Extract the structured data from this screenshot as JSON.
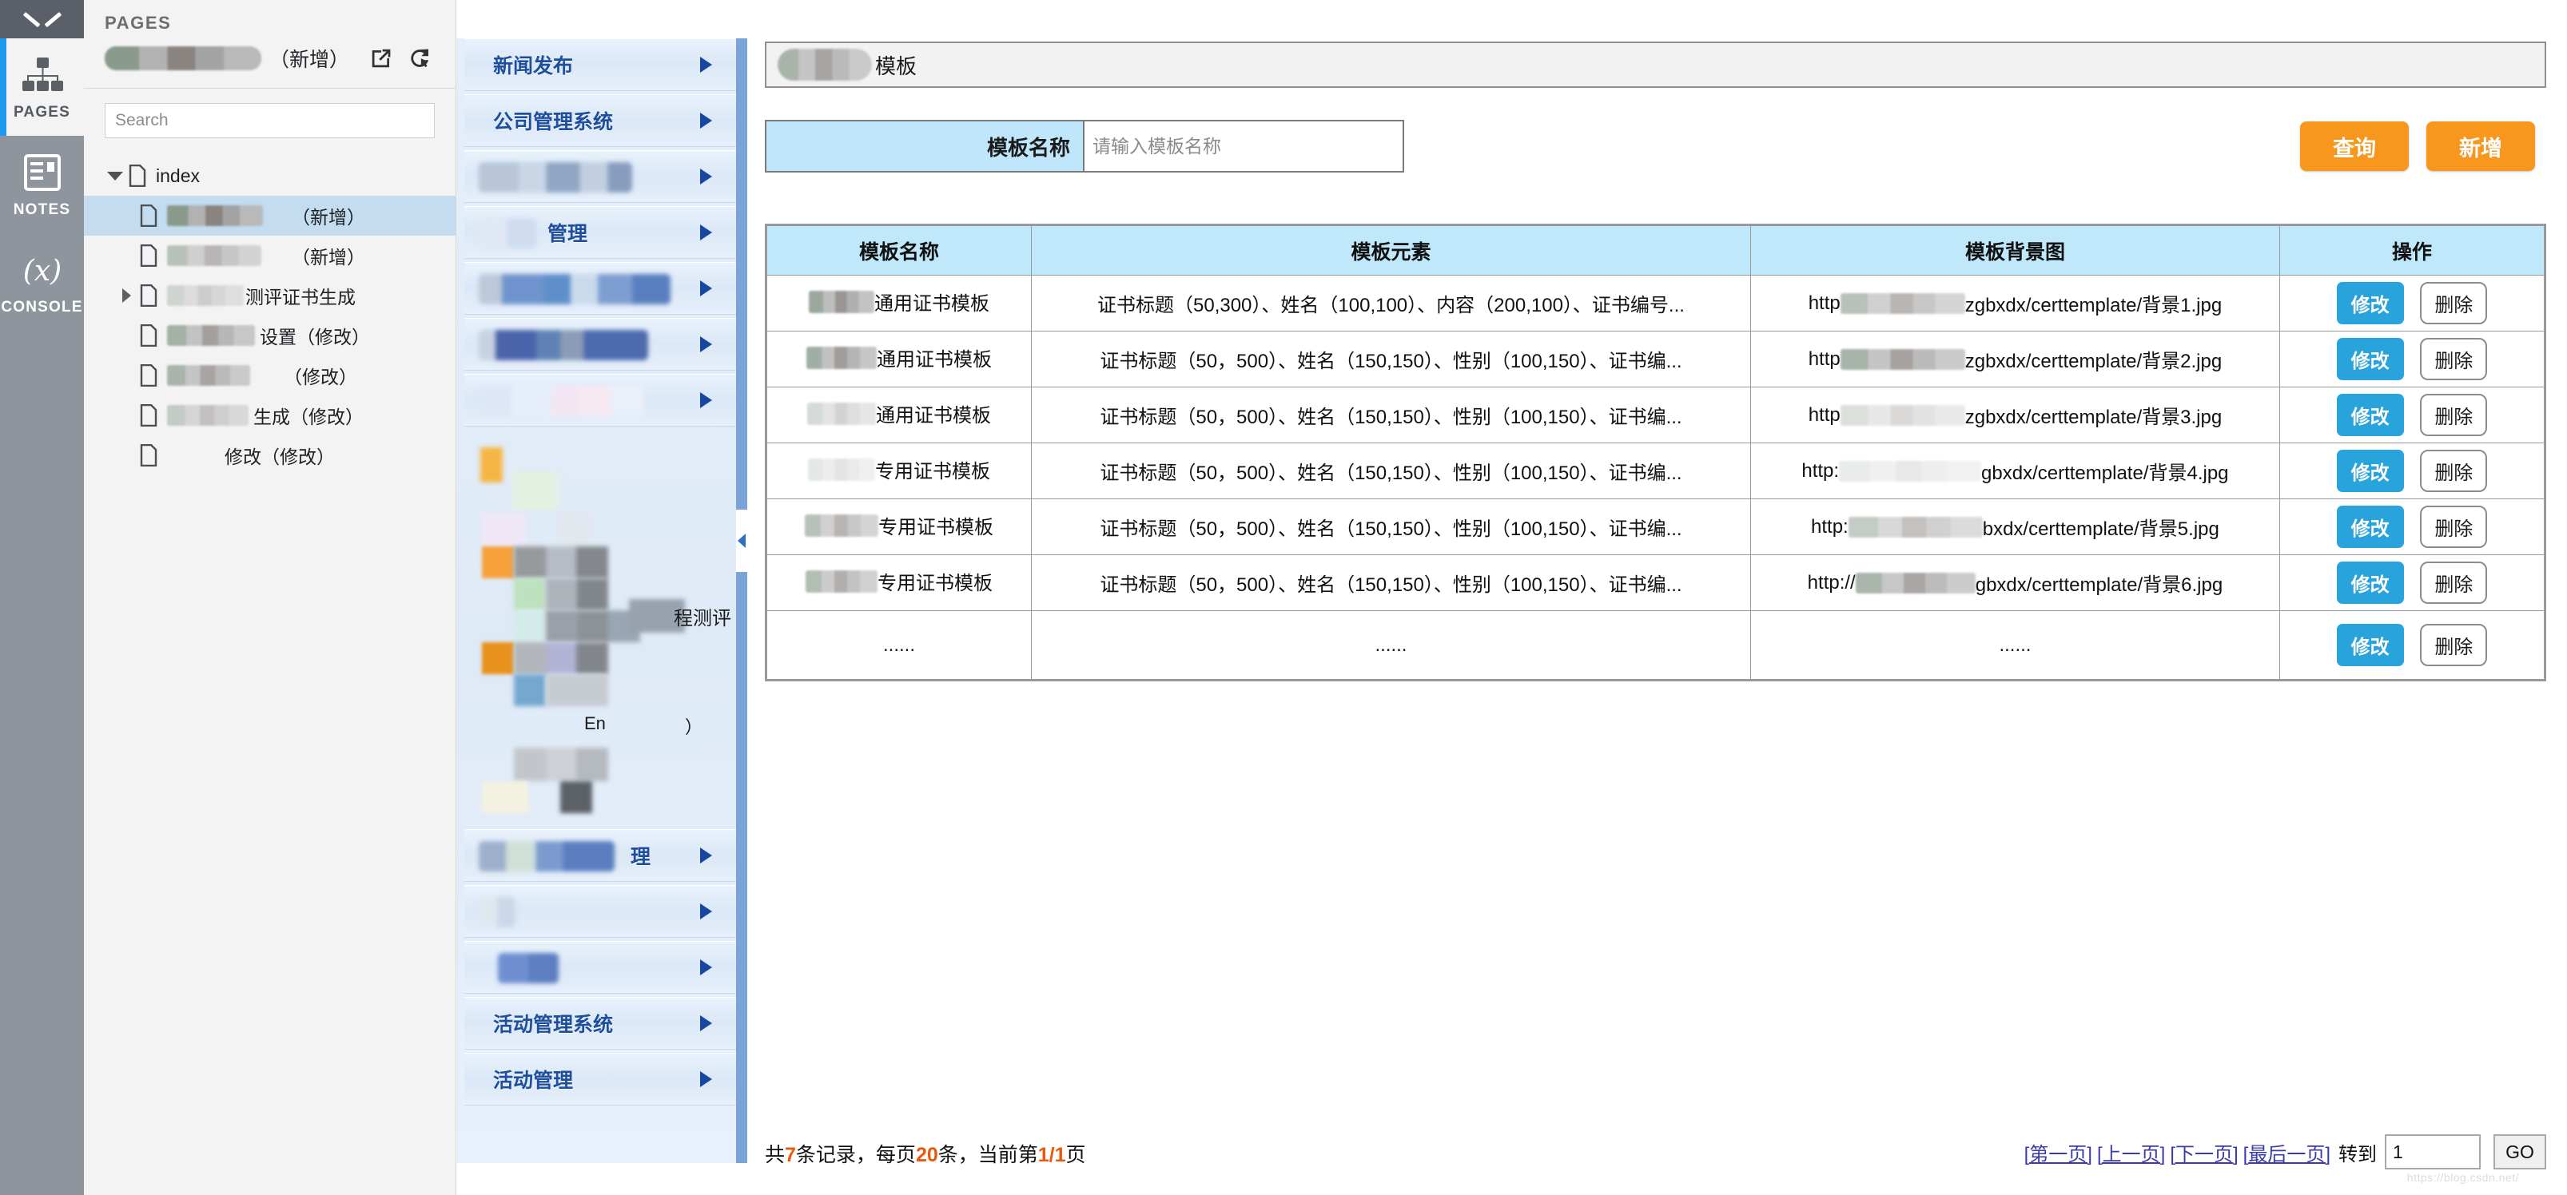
{
  "axure": {
    "rail": {
      "collapse_icon": "chevron-down-icon",
      "items": [
        {
          "label": "PAGES",
          "icon": "sitemap-icon",
          "active": true
        },
        {
          "label": "NOTES",
          "icon": "notes-icon",
          "active": false
        },
        {
          "label": "CONSOLE",
          "icon": "variable-x-icon",
          "active": false
        }
      ]
    },
    "pages_panel": {
      "title": "PAGES",
      "current_page_suffix": "（新增）",
      "open_icon": "open-in-new-window-icon",
      "reload_icon": "reload-cursor-icon",
      "search_placeholder": "Search",
      "search_value": "",
      "tree": [
        {
          "label": "index",
          "level": 0,
          "arrow": "down",
          "selected": false
        },
        {
          "label": "（新增）",
          "level": 1,
          "arrow": "none",
          "selected": true
        },
        {
          "label": "（新增）",
          "level": 1,
          "arrow": "none",
          "selected": false
        },
        {
          "label": "测评证书生成",
          "level": 1,
          "arrow": "right",
          "selected": false
        },
        {
          "label": "设置（修改）",
          "level": 1,
          "arrow": "none",
          "selected": false
        },
        {
          "label": "（修改）",
          "level": 1,
          "arrow": "none",
          "selected": false
        },
        {
          "label": "生成（修改）",
          "level": 1,
          "arrow": "none",
          "selected": false
        },
        {
          "label": "修改（修改）",
          "level": 1,
          "arrow": "none",
          "selected": false
        }
      ]
    }
  },
  "prototype": {
    "nav": {
      "items": [
        {
          "label": "新闻发布",
          "redacted": false
        },
        {
          "label": "公司管理系统",
          "redacted": false
        },
        {
          "label": "",
          "redacted": true
        },
        {
          "label": "管理",
          "redacted": true
        },
        {
          "label": "",
          "redacted": true
        },
        {
          "label": "",
          "redacted": true
        },
        {
          "label": "",
          "redacted": true
        }
      ],
      "items_lower": [
        {
          "label": "理",
          "redacted": true
        },
        {
          "label": "",
          "redacted": true
        },
        {
          "label": "",
          "redacted": true
        },
        {
          "label": "活动管理系统",
          "redacted": false
        },
        {
          "label": "活动管理",
          "redacted": false
        }
      ],
      "collapse_handle": "collapse-left-icon"
    },
    "page_title": "模板",
    "filter": {
      "label": "模板名称",
      "input_value": "",
      "input_placeholder": "请输入模板名称",
      "search_button": "查询",
      "add_button": "新增"
    },
    "table": {
      "columns": [
        "模板名称",
        "模板元素",
        "模板背景图",
        "操作"
      ],
      "rows": [
        {
          "name": "通用证书模板",
          "elements": "证书标题（50,300）、姓名（100,100）、内容（200,100）、证书编号...",
          "url_pre": "http",
          "url_post": "zgbxdx/certtemplate/背景1.jpg",
          "edit": "修改",
          "delete": "删除"
        },
        {
          "name": "通用证书模板",
          "elements": "证书标题（50，500）、姓名（150,150）、性别（100,150）、证书编...",
          "url_pre": "http",
          "url_post": "zgbxdx/certtemplate/背景2.jpg",
          "edit": "修改",
          "delete": "删除"
        },
        {
          "name": "通用证书模板",
          "elements": "证书标题（50，500）、姓名（150,150）、性别（100,150）、证书编...",
          "url_pre": "http",
          "url_post": "zgbxdx/certtemplate/背景3.jpg",
          "edit": "修改",
          "delete": "删除"
        },
        {
          "name": "专用证书模板",
          "elements": "证书标题（50，500）、姓名（150,150）、性别（100,150）、证书编...",
          "url_pre": "http:",
          "url_post": "gbxdx/certtemplate/背景4.jpg",
          "edit": "修改",
          "delete": "删除"
        },
        {
          "name": "专用证书模板",
          "elements": "证书标题（50，500）、姓名（150,150）、性别（100,150）、证书编...",
          "url_pre": "http:",
          "url_post": "bxdx/certtemplate/背景5.jpg",
          "edit": "修改",
          "delete": "删除"
        },
        {
          "name": "专用证书模板",
          "elements": "证书标题（50，500）、姓名（150,150）、性别（100,150）、证书编...",
          "url_pre": "http://",
          "url_post": "gbxdx/certtemplate/背景6.jpg",
          "edit": "修改",
          "delete": "删除"
        },
        {
          "name": "......",
          "elements": "......",
          "url_pre": "......",
          "url_post": "",
          "edit": "修改",
          "delete": "删除"
        }
      ]
    },
    "footer": {
      "record_prefix": "共",
      "record_count": "7",
      "record_middle": "条记录，每页",
      "page_size": "20",
      "record_middle2": "条，当前第",
      "current_page": "1/1",
      "record_suffix": "页",
      "links": [
        "[第一页]",
        "[上一页]",
        "[下一页]",
        "[最后一页]"
      ],
      "goto_label": "转到",
      "goto_value": "1",
      "go_button": "GO",
      "watermark": "https://blog.csdn.net/"
    }
  },
  "colors": {
    "accent_orange": "#f7971e",
    "accent_blue": "#29a3dc",
    "header_blue": "#bfe8fb",
    "nav_text_blue": "#1d4f9e",
    "rail_active_blue": "#1e9bee",
    "highlight_orange": "#e8590c"
  }
}
